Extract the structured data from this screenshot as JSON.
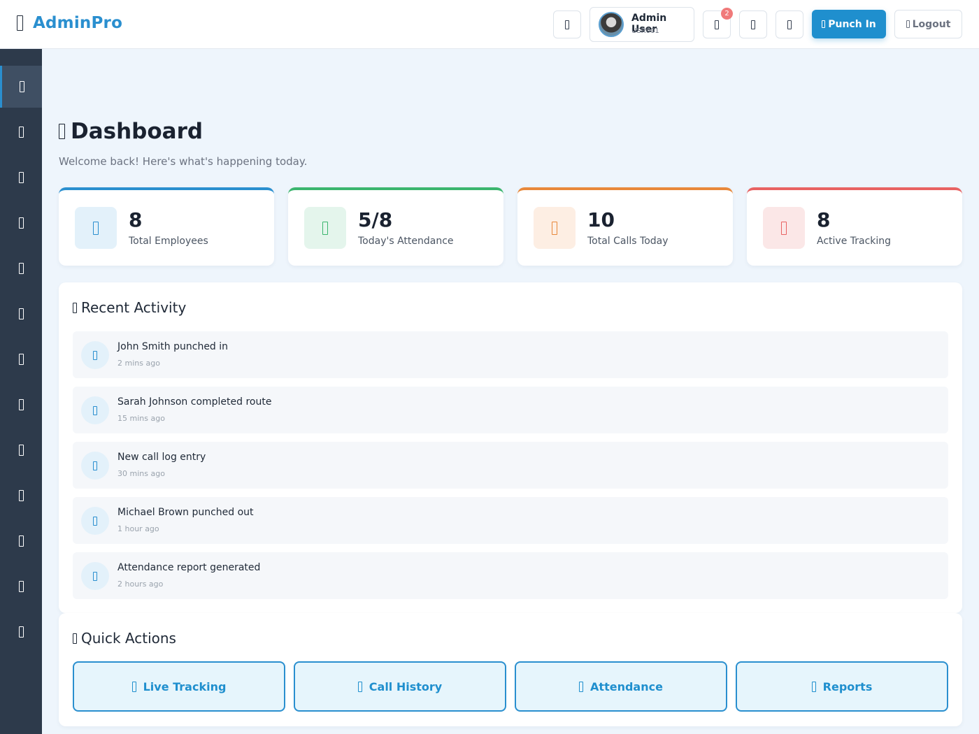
{
  "brand": {
    "name": "AdminPro",
    "icon": "menu-icon"
  },
  "header": {
    "user": {
      "name": "Admin User",
      "id": "USR001"
    },
    "notification_count": "2",
    "punch_label": "Punch In",
    "logout_label": "Logout",
    "icons": [
      "theme-icon",
      "bell-icon",
      "mail-icon",
      "settings-icon"
    ]
  },
  "sidebar": {
    "items": [
      {
        "icon": "dashboard-icon",
        "active": true
      },
      {
        "icon": "users-icon"
      },
      {
        "icon": "clock-icon"
      },
      {
        "icon": "phone-icon"
      },
      {
        "icon": "map-icon"
      },
      {
        "icon": "route-icon"
      },
      {
        "icon": "calendar-icon"
      },
      {
        "icon": "file-icon"
      },
      {
        "icon": "chart-icon"
      },
      {
        "icon": "bell-icon"
      },
      {
        "icon": "settings-icon"
      },
      {
        "icon": "user-icon"
      },
      {
        "icon": "help-icon"
      }
    ]
  },
  "page": {
    "title": "Dashboard",
    "subtitle": "Welcome back! Here's what's happening today."
  },
  "stats": [
    {
      "value": "8",
      "label": "Total Employees",
      "color": "#2a8fcf",
      "bg": "#e3f1fa"
    },
    {
      "value": "5/8",
      "label": "Today's Attendance",
      "color": "#3bb56e",
      "bg": "#e4f5ec"
    },
    {
      "value": "10",
      "label": "Total Calls Today",
      "color": "#e8883a",
      "bg": "#fdeee3"
    },
    {
      "value": "8",
      "label": "Active Tracking",
      "color": "#e86262",
      "bg": "#fbe7e7"
    }
  ],
  "recent_activity": {
    "title": "Recent Activity",
    "items": [
      {
        "text": "John Smith punched in",
        "time": "2 mins ago"
      },
      {
        "text": "Sarah Johnson completed route",
        "time": "15 mins ago"
      },
      {
        "text": "New call log entry",
        "time": "30 mins ago"
      },
      {
        "text": "Michael Brown punched out",
        "time": "1 hour ago"
      },
      {
        "text": "Attendance report generated",
        "time": "2 hours ago"
      }
    ]
  },
  "quick_actions": {
    "title": "Quick Actions",
    "items": [
      {
        "label": "Live Tracking"
      },
      {
        "label": "Call History"
      },
      {
        "label": "Attendance"
      },
      {
        "label": "Reports"
      }
    ]
  }
}
